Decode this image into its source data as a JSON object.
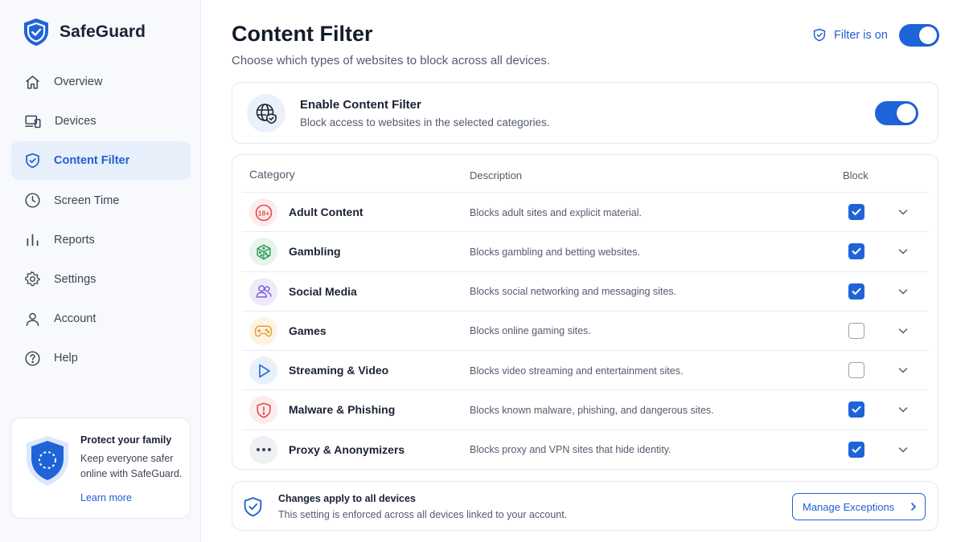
{
  "app": {
    "name": "SafeGuard"
  },
  "sidebar": {
    "items": [
      {
        "label": "Overview",
        "icon": "home-icon"
      },
      {
        "label": "Devices",
        "icon": "devices-icon"
      },
      {
        "label": "Content Filter",
        "icon": "shield-icon",
        "active": true
      },
      {
        "label": "Screen Time",
        "icon": "clock-icon"
      },
      {
        "label": "Reports",
        "icon": "bar-chart-icon"
      },
      {
        "label": "Settings",
        "icon": "gear-icon"
      },
      {
        "label": "Account",
        "icon": "user-icon"
      },
      {
        "label": "Help",
        "icon": "help-icon"
      }
    ],
    "promo": {
      "title": "Protect your family",
      "text": "Keep everyone safer online with SafeGuard.",
      "link": "Learn more"
    }
  },
  "header": {
    "title": "Content Filter",
    "subtitle": "Choose which types of websites to block across all devices.",
    "status": "Filter is on",
    "status_toggle_on": true
  },
  "enable_card": {
    "title": "Enable Content Filter",
    "description": "Block access to websites in the selected categories.",
    "toggle_on": true
  },
  "table": {
    "headers": {
      "category": "Category",
      "description": "Description",
      "block": "Block"
    },
    "rows": [
      {
        "name": "Adult Content",
        "description": "Blocks adult sites and explicit material.",
        "blocked": true,
        "icon": "18-plus-icon",
        "color": "#e5484d",
        "bg": "#fdecec"
      },
      {
        "name": "Gambling",
        "description": "Blocks gambling and betting websites.",
        "blocked": true,
        "icon": "dice-icon",
        "color": "#2f9e5b",
        "bg": "#e6f5ec"
      },
      {
        "name": "Social Media",
        "description": "Blocks social networking and messaging sites.",
        "blocked": true,
        "icon": "users-icon",
        "color": "#7c5cd6",
        "bg": "#efeafb"
      },
      {
        "name": "Games",
        "description": "Blocks online gaming sites.",
        "blocked": false,
        "icon": "gamepad-icon",
        "color": "#e2a03f",
        "bg": "#fdf3e3"
      },
      {
        "name": "Streaming & Video",
        "description": "Blocks video streaming and entertainment sites.",
        "blocked": false,
        "icon": "play-icon",
        "color": "#2f6fdc",
        "bg": "#e8f0fc"
      },
      {
        "name": "Malware & Phishing",
        "description": "Blocks known malware, phishing, and dangerous sites.",
        "blocked": true,
        "icon": "alert-shield-icon",
        "color": "#e5484d",
        "bg": "#fdecec"
      },
      {
        "name": "Proxy & Anonymizers",
        "description": "Blocks proxy and VPN sites that hide identity.",
        "blocked": true,
        "icon": "more-icon",
        "color": "#3c4556",
        "bg": "#eef0f3"
      }
    ]
  },
  "footer": {
    "title": "Changes apply to all devices",
    "description": "This setting is enforced across all devices linked to your account.",
    "button": "Manage Exceptions"
  },
  "colors": {
    "accent": "#1f63d8",
    "sidebar_bg": "#f7f9fc",
    "active_bg": "#e7effb"
  }
}
